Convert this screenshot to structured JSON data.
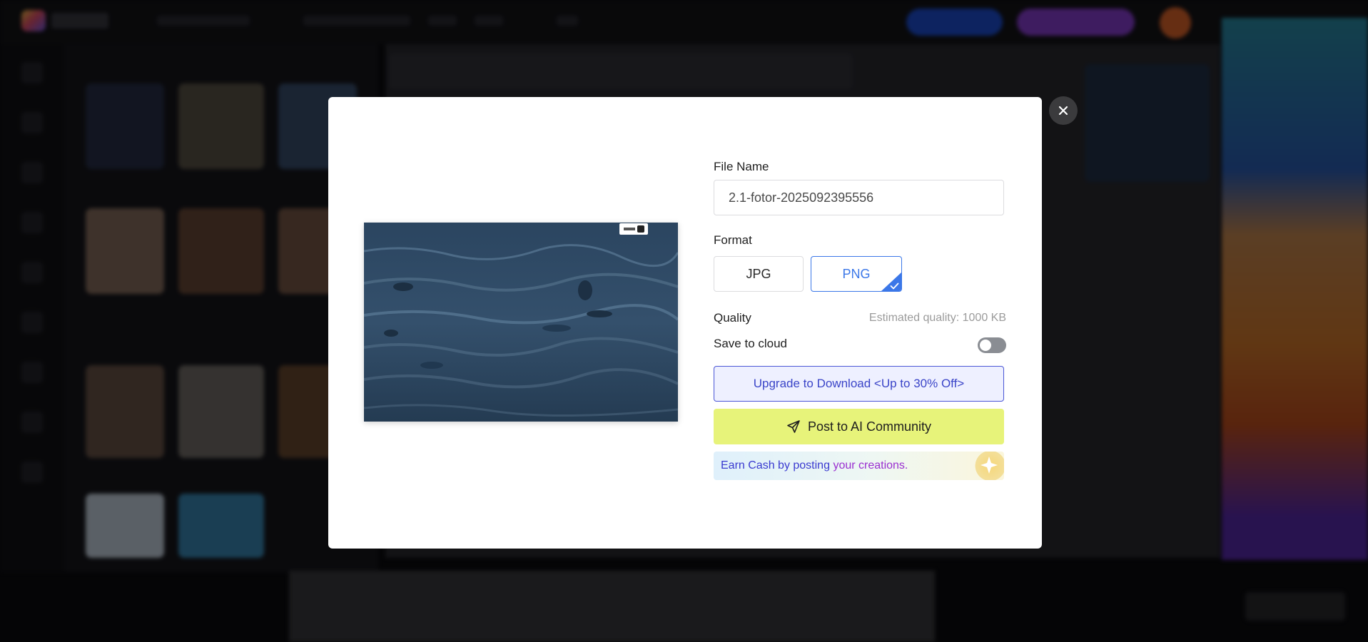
{
  "dialog": {
    "file_name_label": "File Name",
    "file_name_value": "2.1-fotor-2025092395556",
    "format_label": "Format",
    "formats": [
      "JPG",
      "PNG"
    ],
    "selected_format": "PNG",
    "quality_label": "Quality",
    "estimated_quality": "Estimated quality: 1000 KB",
    "save_to_cloud_label": "Save to cloud",
    "save_to_cloud_enabled": false,
    "upgrade_button": "Upgrade to Download <Up to 30% Off>",
    "post_button": "Post to AI Community",
    "earn_tip_part1": "Earn Cash by posting",
    "earn_tip_part2": "your creations."
  },
  "icons": {
    "close": "close-icon",
    "send": "send-icon",
    "check": "check-icon",
    "star": "sparkle-icon"
  },
  "colors": {
    "accent": "#3b77e8",
    "upgrade_text": "#3a44c8",
    "post_bg": "#e7f37a",
    "earn_purple": "#9a2fd0"
  }
}
